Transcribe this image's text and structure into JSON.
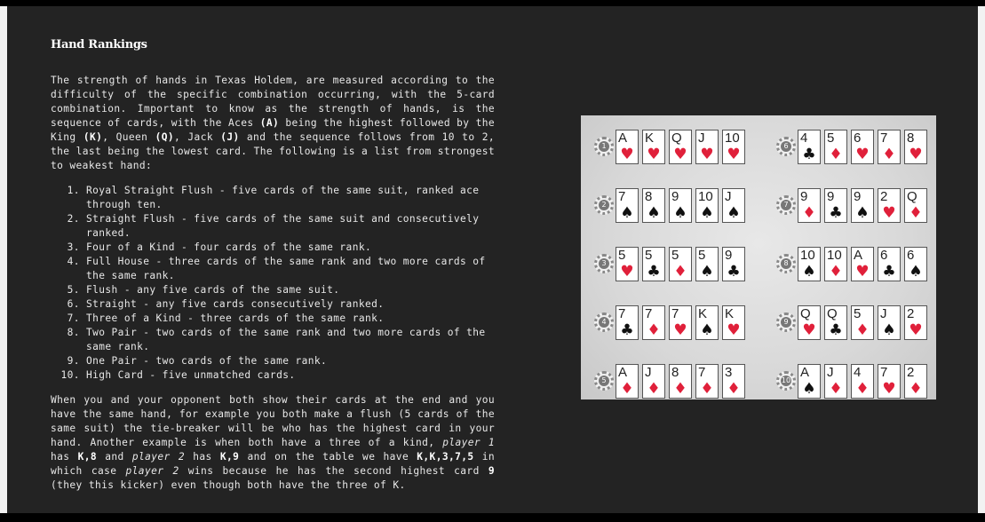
{
  "article": {
    "title": "Hand Rankings",
    "intro": {
      "t1": "The strength of hands in Texas Holdem, are measured according to the difficulty of the specific combination occurring, with the 5-card combination. Important to know as the strength of hands, is the sequence of cards, with the Aces ",
      "b1": "(A)",
      "t2": " being the highest followed by the King ",
      "b2": "(K)",
      "t3": ", Queen ",
      "b3": "(Q)",
      "t4": ", Jack ",
      "b4": "(J)",
      "t5": " and the sequence follows from 10 to 2, the last being the lowest card. The following is a list from strongest to weakest hand:"
    },
    "rankings": [
      "Royal Straight Flush - five cards of the same suit, ranked ace through ten.",
      "Straight Flush - five cards of the same suit and consecutively ranked.",
      "Four of a Kind - four cards of the same rank.",
      "Full House - three cards of the same rank and two more cards of the same rank.",
      "Flush - any five cards of the same suit.",
      "Straight - any five cards consecutively ranked.",
      "Three of a Kind - three cards of the same rank.",
      "Two Pair - two cards of the same rank and two more cards of the same rank.",
      "One Pair - two cards of the same rank.",
      "High Card - five unmatched cards."
    ],
    "tiebreak": {
      "t1": "When you and your opponent both show their cards at the end and you have the same hand, for example you both make a flush (5 cards of the same suit) the tie-breaker will be who has the highest card in your hand. Another example is when both have a three of a kind, ",
      "i1": "player 1",
      "t2": " has ",
      "b1": "K,8",
      "t3": " and ",
      "i2": "player 2",
      "t4": " has ",
      "b2": "K,9",
      "t5": " and on the table we have ",
      "b3": "K,K,3,7,5",
      "t6": " in which case ",
      "i3": "player 2",
      "t7": " wins because he has the second highest card ",
      "b4": "9",
      "t8": " (they this kicker) even though both have the three of K."
    }
  },
  "hands_image": {
    "suit_symbols": {
      "hearts": "♥",
      "diamonds": "♦",
      "spades": "♠",
      "clubs": "♣"
    },
    "colors": {
      "red": "#e0203a",
      "black": "#111111"
    },
    "hands": [
      {
        "rank_no": "1",
        "cards": [
          [
            "A",
            "hearts"
          ],
          [
            "K",
            "hearts"
          ],
          [
            "Q",
            "hearts"
          ],
          [
            "J",
            "hearts"
          ],
          [
            "10",
            "hearts"
          ]
        ]
      },
      {
        "rank_no": "2",
        "cards": [
          [
            "7",
            "spades"
          ],
          [
            "8",
            "spades"
          ],
          [
            "9",
            "spades"
          ],
          [
            "10",
            "spades"
          ],
          [
            "J",
            "spades"
          ]
        ]
      },
      {
        "rank_no": "3",
        "cards": [
          [
            "5",
            "hearts"
          ],
          [
            "5",
            "clubs"
          ],
          [
            "5",
            "diamonds"
          ],
          [
            "5",
            "spades"
          ],
          [
            "9",
            "clubs"
          ]
        ]
      },
      {
        "rank_no": "4",
        "cards": [
          [
            "7",
            "clubs"
          ],
          [
            "7",
            "diamonds"
          ],
          [
            "7",
            "hearts"
          ],
          [
            "K",
            "spades"
          ],
          [
            "K",
            "hearts"
          ]
        ]
      },
      {
        "rank_no": "5",
        "cards": [
          [
            "A",
            "diamonds"
          ],
          [
            "J",
            "diamonds"
          ],
          [
            "8",
            "diamonds"
          ],
          [
            "7",
            "diamonds"
          ],
          [
            "3",
            "diamonds"
          ]
        ]
      },
      {
        "rank_no": "6",
        "cards": [
          [
            "4",
            "clubs"
          ],
          [
            "5",
            "diamonds"
          ],
          [
            "6",
            "hearts"
          ],
          [
            "7",
            "diamonds"
          ],
          [
            "8",
            "hearts"
          ]
        ]
      },
      {
        "rank_no": "7",
        "cards": [
          [
            "9",
            "diamonds"
          ],
          [
            "9",
            "clubs"
          ],
          [
            "9",
            "spades"
          ],
          [
            "2",
            "hearts"
          ],
          [
            "Q",
            "diamonds"
          ]
        ]
      },
      {
        "rank_no": "8",
        "cards": [
          [
            "10",
            "spades"
          ],
          [
            "10",
            "diamonds"
          ],
          [
            "A",
            "hearts"
          ],
          [
            "6",
            "clubs"
          ],
          [
            "6",
            "spades"
          ]
        ]
      },
      {
        "rank_no": "9",
        "cards": [
          [
            "Q",
            "hearts"
          ],
          [
            "Q",
            "clubs"
          ],
          [
            "5",
            "diamonds"
          ],
          [
            "J",
            "spades"
          ],
          [
            "2",
            "hearts"
          ]
        ]
      },
      {
        "rank_no": "10",
        "cards": [
          [
            "A",
            "spades"
          ],
          [
            "J",
            "diamonds"
          ],
          [
            "4",
            "diamonds"
          ],
          [
            "7",
            "hearts"
          ],
          [
            "2",
            "diamonds"
          ]
        ]
      }
    ]
  }
}
